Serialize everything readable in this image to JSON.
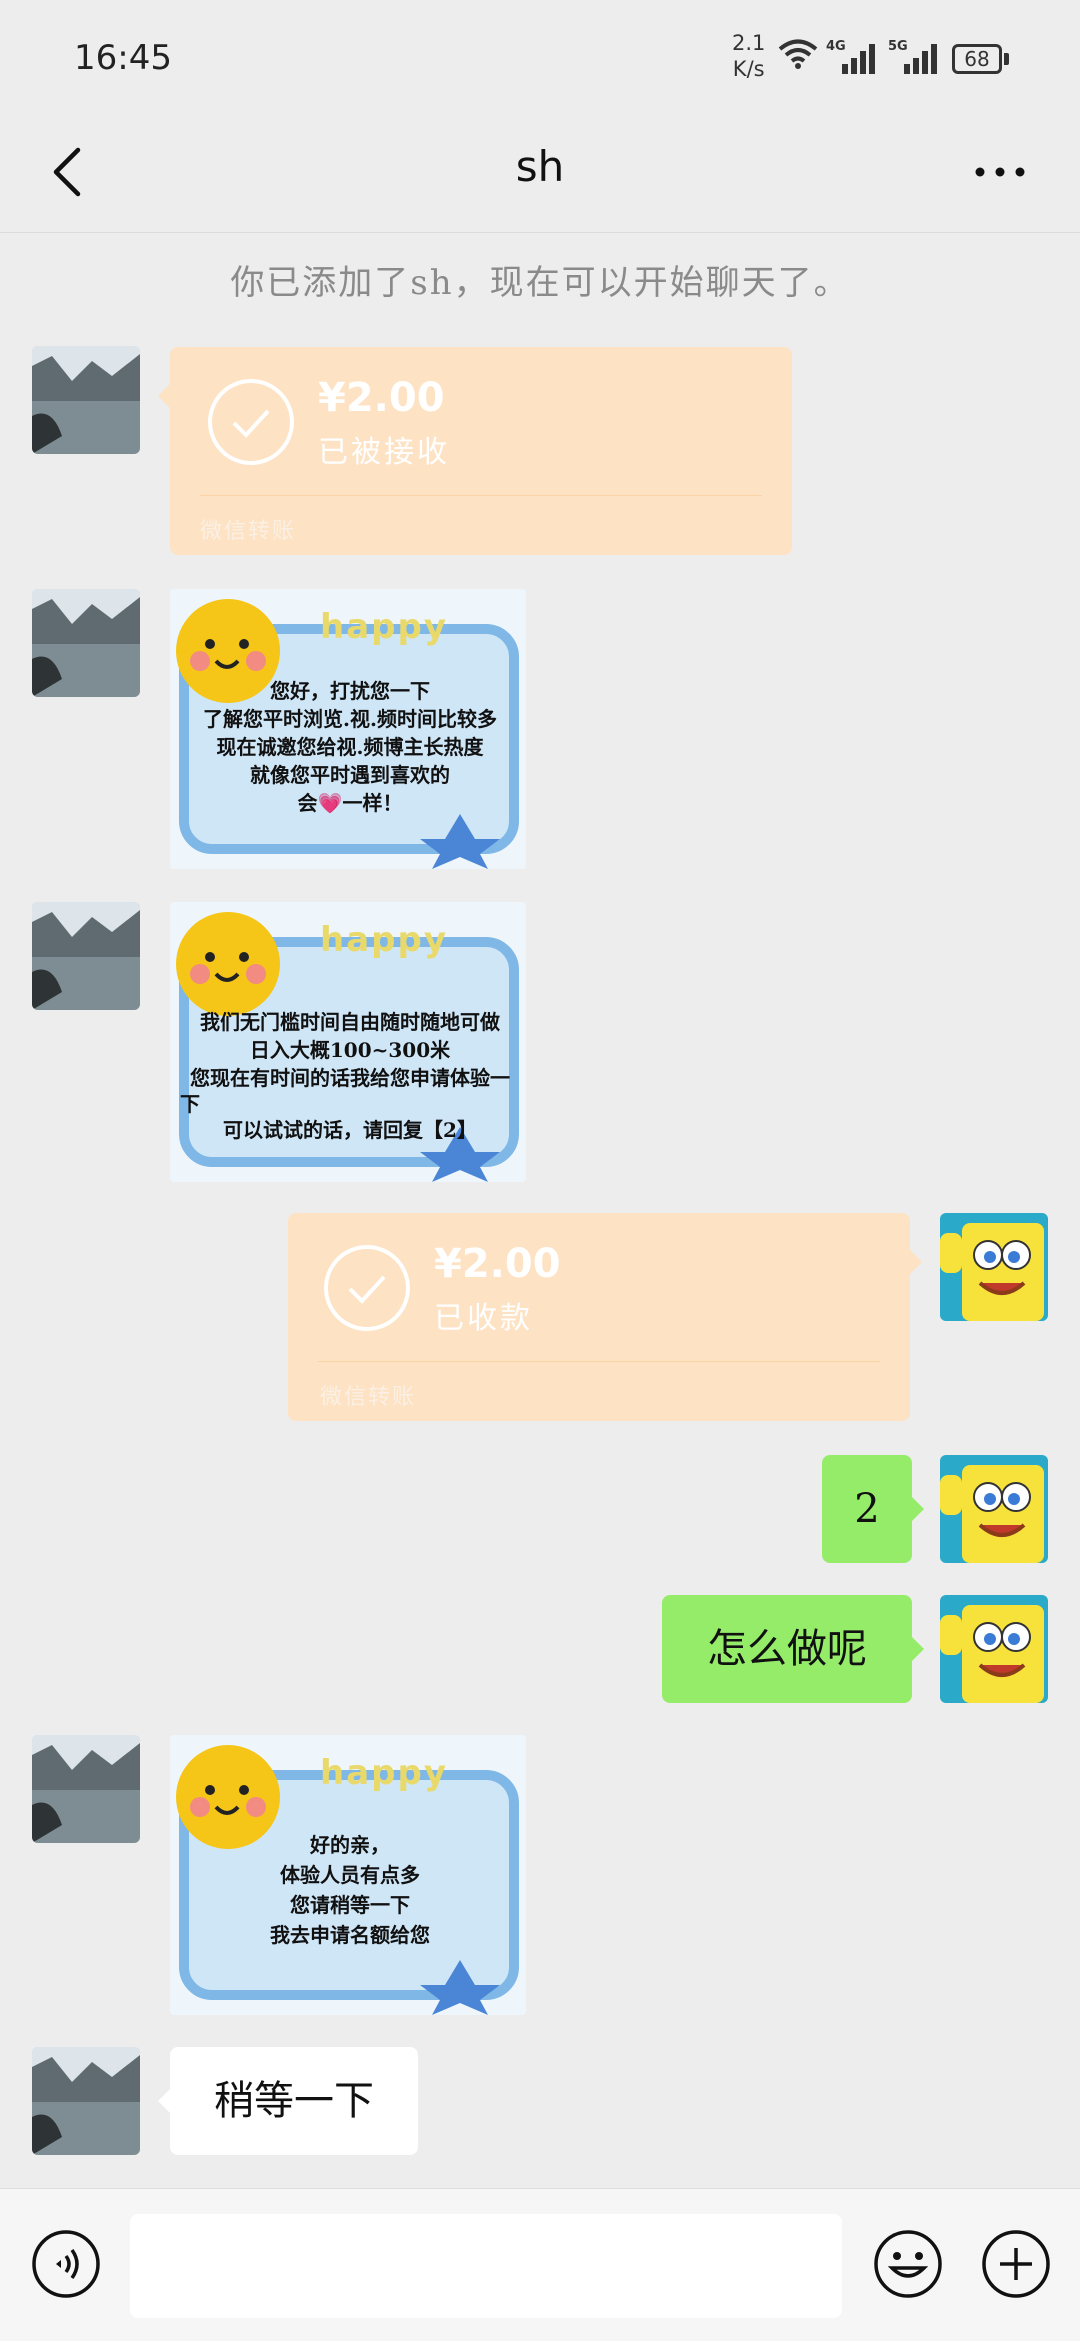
{
  "status_bar": {
    "time": "16:45",
    "net_speed_value": "2.1",
    "net_speed_unit": "K/s",
    "sig1_label": "4G",
    "sig2_label": "5G",
    "battery": "68"
  },
  "header": {
    "title": "sh",
    "back_icon": "chevron-left-icon",
    "more_icon": "more-dots-icon"
  },
  "system_message": "你已添加了sh，现在可以开始聊天了。",
  "messages": [
    {
      "side": "left",
      "type": "transfer",
      "amount": "¥2.00",
      "status": "已被接收",
      "footer": "微信转账"
    },
    {
      "side": "left",
      "type": "image",
      "sticker_word": "happy",
      "lines": [
        "您好，打扰您一下",
        "了解您平时浏览.视.频时间比较多",
        "现在诚邀您给视.频博主长热度",
        "就像您平时遇到喜欢的",
        "会💗一样！"
      ]
    },
    {
      "side": "left",
      "type": "image",
      "sticker_word": "happy",
      "lines": [
        "我们无门槛时间自由随时随地可做",
        "日入大概100~300米",
        "您现在有时间的话我给您申请体验一",
        "下",
        "可以试试的话，请回复【2】"
      ]
    },
    {
      "side": "right",
      "type": "transfer",
      "amount": "¥2.00",
      "status": "已收款",
      "footer": "微信转账"
    },
    {
      "side": "right",
      "type": "text",
      "text": "2"
    },
    {
      "side": "right",
      "type": "text",
      "text": "怎么做呢"
    },
    {
      "side": "left",
      "type": "image",
      "sticker_word": "happy",
      "lines": [
        "好的亲，",
        "体验人员有点多",
        "您请稍等一下",
        "我去申请名额给您"
      ]
    },
    {
      "side": "left",
      "type": "text",
      "text": "稍等一下"
    }
  ],
  "bottom_bar": {
    "voice_icon": "voice-icon",
    "input_value": "",
    "emoji_icon": "emoji-icon",
    "plus_icon": "plus-icon"
  },
  "colors": {
    "background": "#ededed",
    "transfer_card": "#fde2c4",
    "bubble_green": "#95ec69",
    "bubble_white": "#ffffff"
  }
}
